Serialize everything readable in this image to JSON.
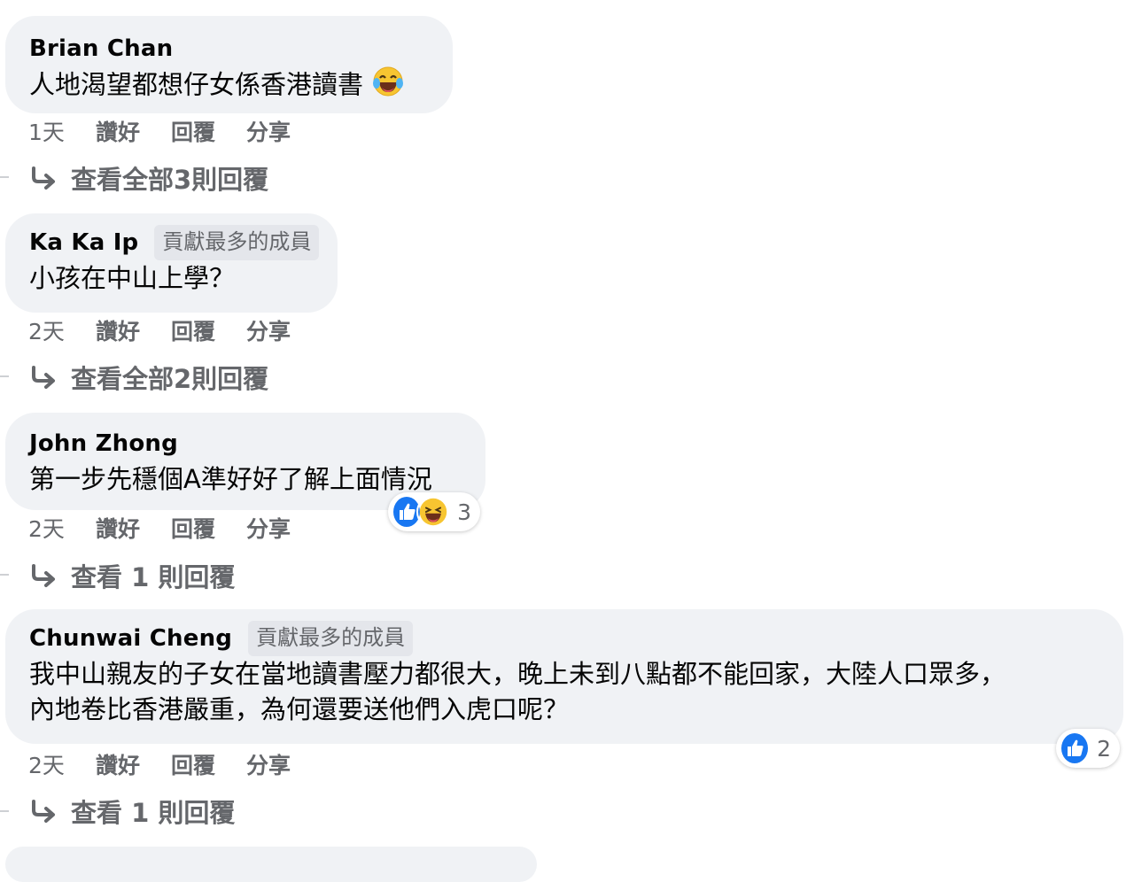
{
  "comments": [
    {
      "author": "Brian Chan",
      "badge": "",
      "text": "人地渴望都想仔女係香港讀書",
      "time": "1天",
      "like": "讚好",
      "reply": "回覆",
      "share": "分享",
      "view_replies": "查看全部3則回覆"
    },
    {
      "author": "Ka Ka Ip",
      "badge": "貢獻最多的成員",
      "text": "小孩在中山上學？",
      "time": "2天",
      "like": "讚好",
      "reply": "回覆",
      "share": "分享",
      "view_replies": "查看全部2則回覆"
    },
    {
      "author": "John Zhong",
      "badge": "",
      "text": "第一步先穩個A準好好了解上面情況",
      "time": "2天",
      "like": "讚好",
      "reply": "回覆",
      "share": "分享",
      "view_replies": "查看 1 則回覆",
      "reaction_count": "3",
      "reaction_icons": [
        "like-icon",
        "haha-icon"
      ]
    },
    {
      "author": "Chunwai Cheng",
      "badge": "貢獻最多的成員",
      "text_line1": "我中山親友的子女在當地讀書壓力都很大，晚上未到八點都不能回家，大陸人口眾多，",
      "text_line2": "內地卷比香港嚴重，為何還要送他們入虎口呢？",
      "time": "2天",
      "like": "讚好",
      "reply": "回覆",
      "share": "分享",
      "view_replies": "查看 1 則回覆",
      "reaction_count": "2",
      "reaction_icons": [
        "like-icon"
      ]
    }
  ],
  "colors": {
    "bubble": "#f0f2f5",
    "secondary_text": "#65676b",
    "like_blue": "#1877f2",
    "badge_bg": "#e4e6eb"
  }
}
